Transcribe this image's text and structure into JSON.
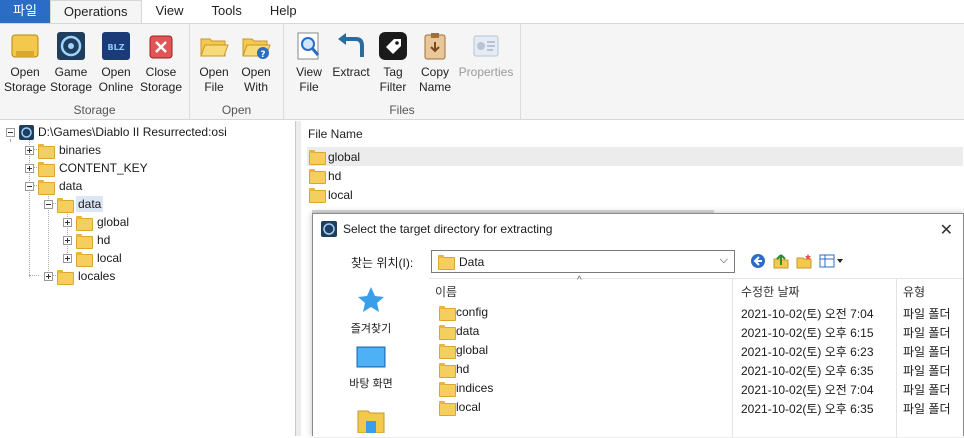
{
  "menu": {
    "tabs": [
      {
        "label": "파일",
        "kind": "file"
      },
      {
        "label": "Operations",
        "kind": "active"
      },
      {
        "label": "View",
        "kind": ""
      },
      {
        "label": "Tools",
        "kind": ""
      },
      {
        "label": "Help",
        "kind": ""
      }
    ]
  },
  "ribbon": {
    "groups": {
      "storage": "Storage",
      "open": "Open",
      "files": "Files"
    },
    "buttons": {
      "open_storage": [
        "Open",
        "Storage"
      ],
      "game_storage": [
        "Game",
        "Storage"
      ],
      "open_online": [
        "Open",
        "Online"
      ],
      "close_storage": [
        "Close",
        "Storage"
      ],
      "open_file": [
        "Open",
        "File"
      ],
      "open_with": [
        "Open",
        "With"
      ],
      "view_file": [
        "View",
        "File"
      ],
      "extract": [
        "Extract",
        ""
      ],
      "tag_filter": [
        "Tag",
        "Filter"
      ],
      "copy_name": [
        "Copy",
        "Name"
      ],
      "properties": [
        "Properties",
        ""
      ]
    }
  },
  "tree": {
    "root": "D:\\Games\\Diablo II Resurrected:osi",
    "binaries": "binaries",
    "content_key": "CONTENT_KEY",
    "data": "data",
    "data_data": "data",
    "global": "global",
    "hd": "hd",
    "local": "local",
    "locales": "locales"
  },
  "filelist": {
    "header": "File Name",
    "rows": [
      "global",
      "hd",
      "local"
    ]
  },
  "dialog": {
    "title": "Select the target directory for extracting",
    "lookin_label": "찾는 위치(I):",
    "lookin_value": "Data",
    "places": {
      "favorites": "즐겨찾기",
      "desktop": "바탕 화면"
    },
    "columns": {
      "name": "이름",
      "modified": "수정한 날짜",
      "type": "유형"
    },
    "rows": [
      {
        "name": "config",
        "date": "2021-10-02(토) 오전 7:04",
        "type": "파일 폴더"
      },
      {
        "name": "data",
        "date": "2021-10-02(토) 오후 6:15",
        "type": "파일 폴더"
      },
      {
        "name": "global",
        "date": "2021-10-02(토) 오후 6:23",
        "type": "파일 폴더"
      },
      {
        "name": "hd",
        "date": "2021-10-02(토) 오후 6:35",
        "type": "파일 폴더"
      },
      {
        "name": "indices",
        "date": "2021-10-02(토) 오전 7:04",
        "type": "파일 폴더"
      },
      {
        "name": "local",
        "date": "2021-10-02(토) 오후 6:35",
        "type": "파일 폴더"
      }
    ]
  },
  "colors": {
    "file_tab": "#2b6cc4",
    "folder": "#f5cf5e",
    "selection": "#dce7f5"
  }
}
